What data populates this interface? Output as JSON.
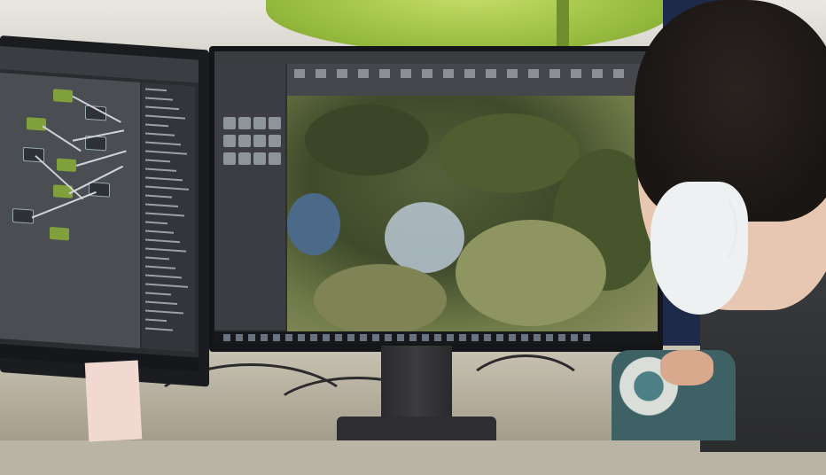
{
  "scene": {
    "description_kind": "photo",
    "colors": {
      "lamp": "#93b83c",
      "node_green": "#7fa03a",
      "editor_dark": "#2d2f33",
      "viewport_foliage": "#4e5e30",
      "mask": "#eef1f2",
      "hair": "#1a1614"
    }
  },
  "left_monitor": {
    "nodes": [
      {
        "dark": false
      },
      {
        "dark": true
      },
      {
        "dark": false
      },
      {
        "dark": true
      },
      {
        "dark": true
      },
      {
        "dark": false
      },
      {
        "dark": true
      },
      {
        "dark": false
      },
      {
        "dark": true
      },
      {
        "dark": false
      }
    ],
    "panel_rows": 28
  },
  "mid_monitor": {
    "toolbar_icons": 16,
    "content_tiles": 12,
    "taskbar_icons": 30
  }
}
